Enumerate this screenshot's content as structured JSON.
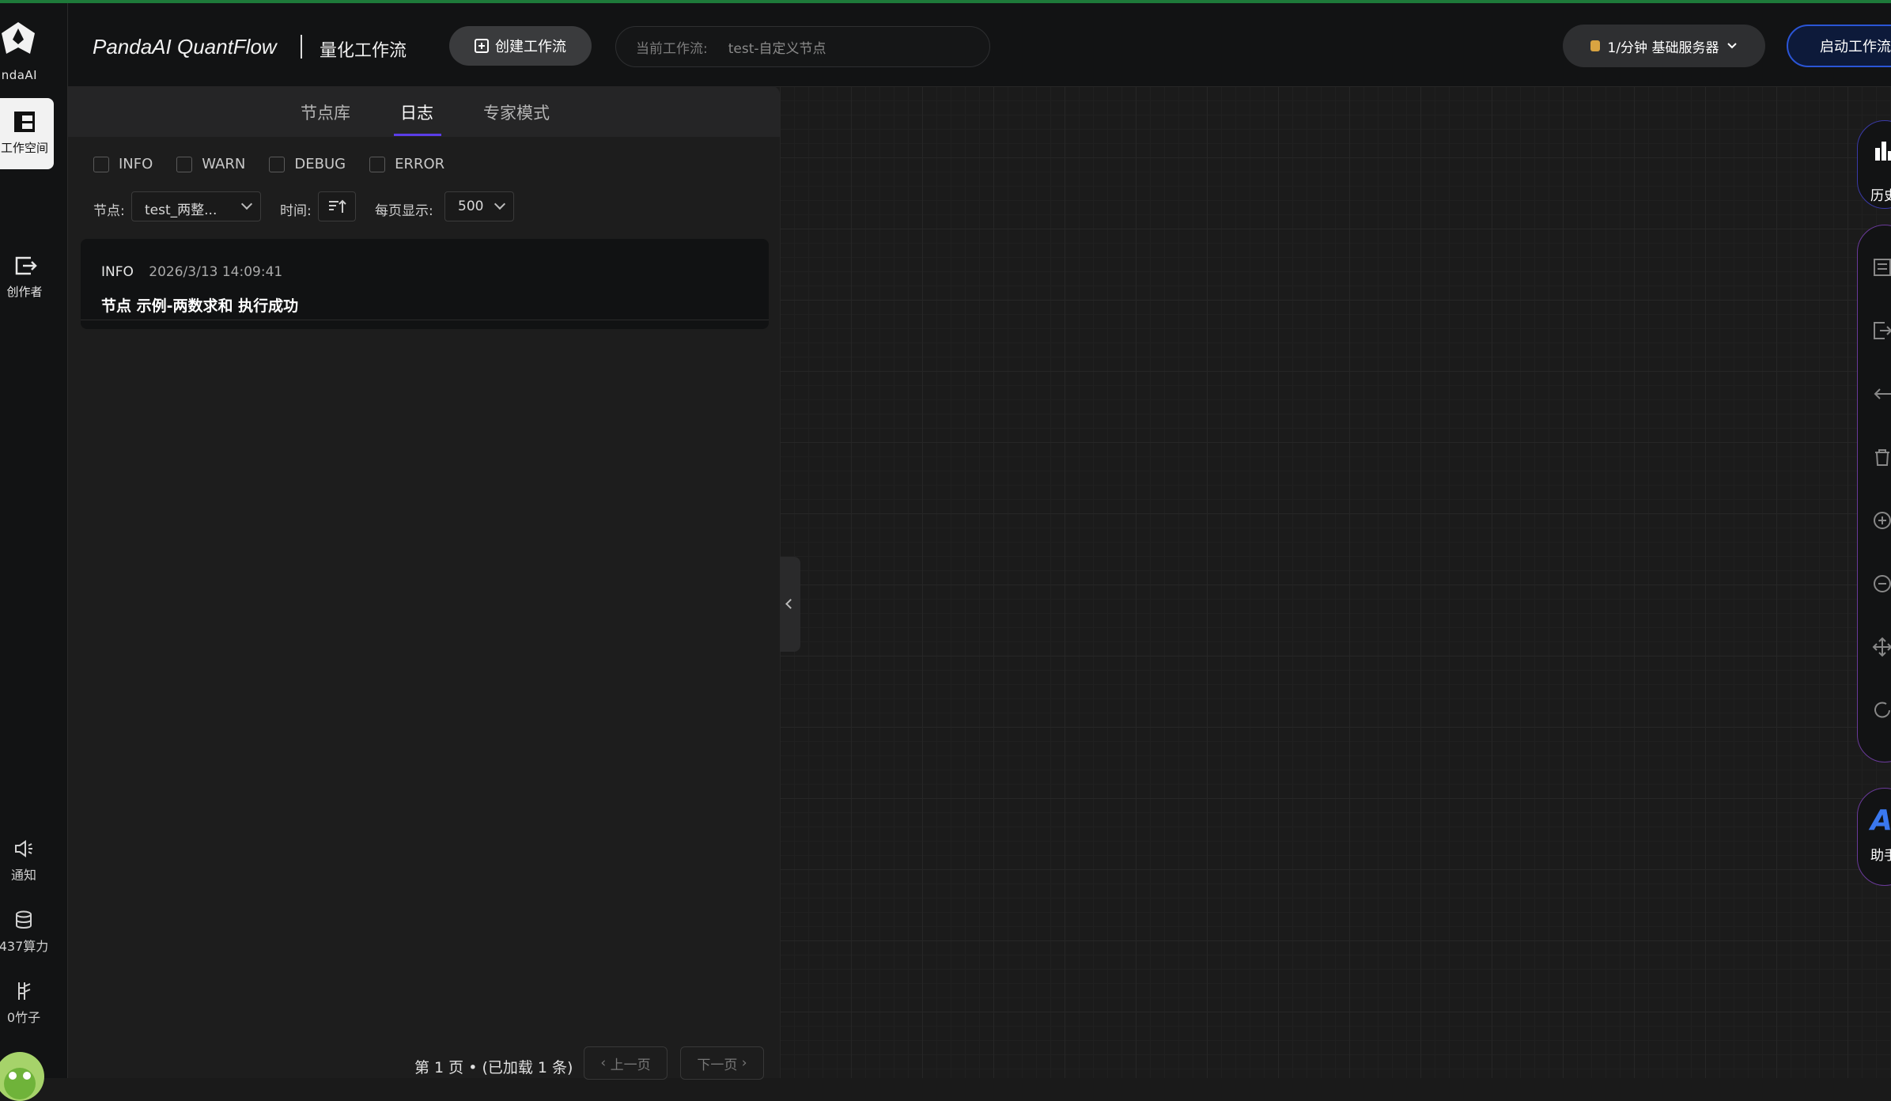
{
  "sidebar": {
    "logo_text": "andaAI",
    "items": [
      {
        "label": "工作空间",
        "active": true
      },
      {
        "label": "创作者",
        "active": false
      }
    ],
    "bottom": [
      {
        "label": "通知"
      },
      {
        "label": "437算力"
      },
      {
        "label": "0竹子"
      }
    ]
  },
  "header": {
    "brand": "PandaAI QuantFlow",
    "subtitle": "量化工作流",
    "create_button": "创建工作流",
    "current_workflow_label": "当前工作流:",
    "current_workflow_value": "test-自定义节点",
    "server_button": "1/分钟  基础服务器",
    "start_button": "启动工作流"
  },
  "panel": {
    "tabs": [
      "节点库",
      "日志",
      "专家模式"
    ],
    "active_tab": "日志",
    "levels": [
      "INFO",
      "WARN",
      "DEBUG",
      "ERROR"
    ],
    "filters": {
      "node_label": "节点:",
      "node_value": "test_两整...",
      "time_label": "时间:",
      "page_size_label": "每页显示:",
      "page_size_value": "500"
    },
    "logs": [
      {
        "level": "INFO",
        "time": "2026/3/13 14:09:41",
        "message": "节点 示例-两数求和 执行成功"
      }
    ],
    "pager": {
      "info": "第 1 页 • (已加载 1 条)",
      "prev": "上一页",
      "next": "下一页"
    }
  },
  "right_toolbar": {
    "history_label": "历史",
    "ai_letter": "A",
    "ai_label": "助手"
  },
  "colors": {
    "accent_line": "#1e7a3a",
    "tab_underline": "#5b3ee8",
    "start_border": "#2a55d6"
  }
}
